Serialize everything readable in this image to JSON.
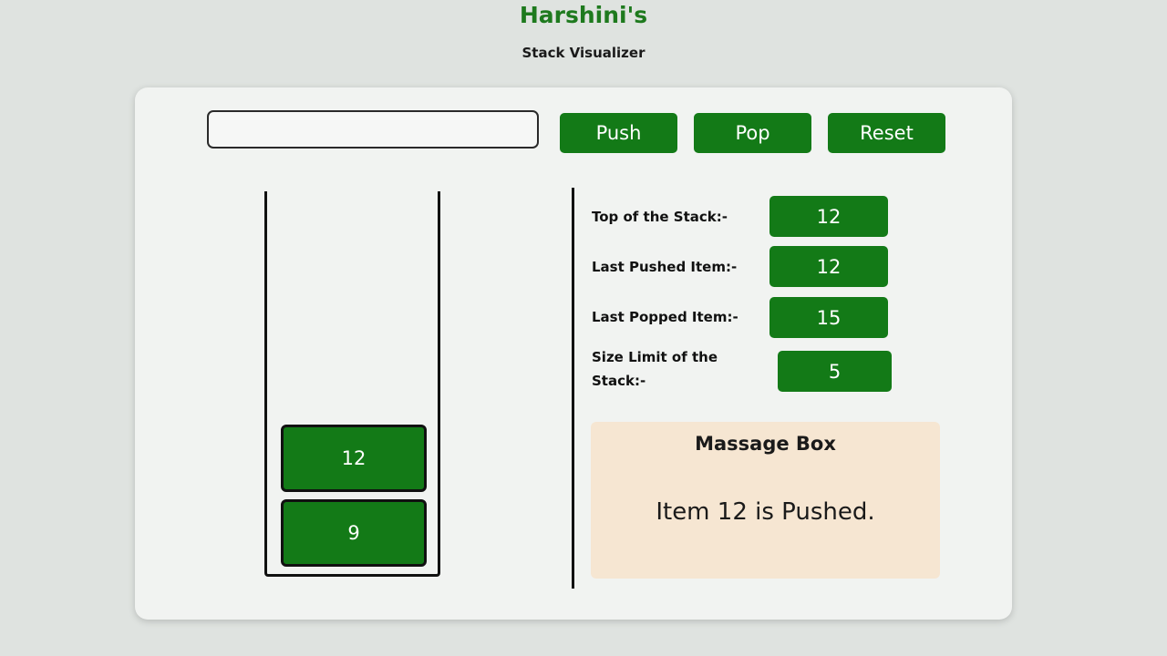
{
  "header": {
    "title": "Harshini's",
    "subtitle": "Stack Visualizer"
  },
  "controls": {
    "input": {
      "value": "",
      "placeholder": ""
    },
    "push_label": "Push",
    "pop_label": "Pop",
    "reset_label": "Reset"
  },
  "stack": {
    "items": [
      "12",
      "9"
    ]
  },
  "info": {
    "top_label": "Top of the Stack:-",
    "top_value": "12",
    "last_pushed_label": "Last Pushed Item:-",
    "last_pushed_value": "12",
    "last_popped_label": "Last Popped Item:-",
    "last_popped_value": "15",
    "size_limit_label": "Size Limit of the Stack:-",
    "size_limit_value": "5"
  },
  "message_box": {
    "title": "Massage Box",
    "text": "Item 12 is Pushed."
  },
  "colors": {
    "accent_green": "#137a17",
    "title_green": "#1e7a1e",
    "message_bg": "#f6e6d2"
  }
}
